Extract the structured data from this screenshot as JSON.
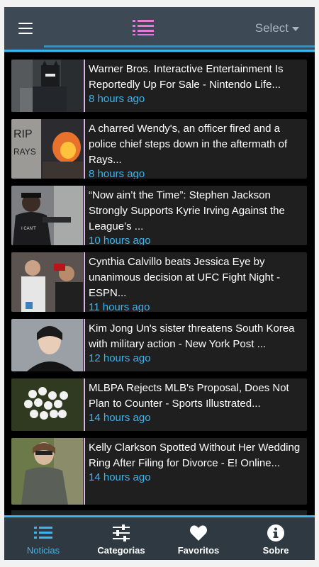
{
  "header": {
    "select_label": "Select"
  },
  "articles": [
    {
      "title": "Warner Bros. Interactive Entertainment Is Reportedly Up For Sale - Nintendo Life...",
      "time": "8 hours ago",
      "thumb": "batman-lego-thumbnail"
    },
    {
      "title": "A charred Wendy's, an officer fired and a police chief steps down in the aftermath of Rays...",
      "time": "8 hours ago",
      "thumb": "fire-protest-thumbnail"
    },
    {
      "title": "“Now ain’t the Time”: Stephen Jackson Strongly Supports Kyrie Irving Against the League’s ...",
      "time": "10 hours ago",
      "thumb": "stephen-jackson-thumbnail"
    },
    {
      "title": "Cynthia Calvillo beats Jessica Eye by unanimous decision at UFC Fight Night - ESPN...",
      "time": "11 hours ago",
      "thumb": "ufc-fight-thumbnail"
    },
    {
      "title": "Kim Jong Un's sister threatens South Korea with military action - New York Post ...",
      "time": "12 hours ago",
      "thumb": "kim-yo-jong-thumbnail"
    },
    {
      "title": "MLBPA Rejects MLB's Proposal, Does Not Plan to Counter - Sports Illustrated...",
      "time": "14 hours ago",
      "thumb": "baseballs-thumbnail"
    },
    {
      "title": "Kelly Clarkson Spotted Without Her Wedding Ring After Filing for Divorce - E! Online...",
      "time": "14 hours ago",
      "thumb": "kelly-clarkson-thumbnail"
    }
  ],
  "tabs": [
    {
      "label": "Noticias",
      "icon": "list-icon",
      "active": true
    },
    {
      "label": "Categorias",
      "icon": "sliders-icon",
      "active": false
    },
    {
      "label": "Favoritos",
      "icon": "heart-icon",
      "active": false
    },
    {
      "label": "Sobre",
      "icon": "info-icon",
      "active": false
    }
  ],
  "colors": {
    "accent": "#3db4ee",
    "header_bg": "#3d4a56",
    "card_bg": "#1f1f1f",
    "list_icon": "#e27ad6"
  }
}
